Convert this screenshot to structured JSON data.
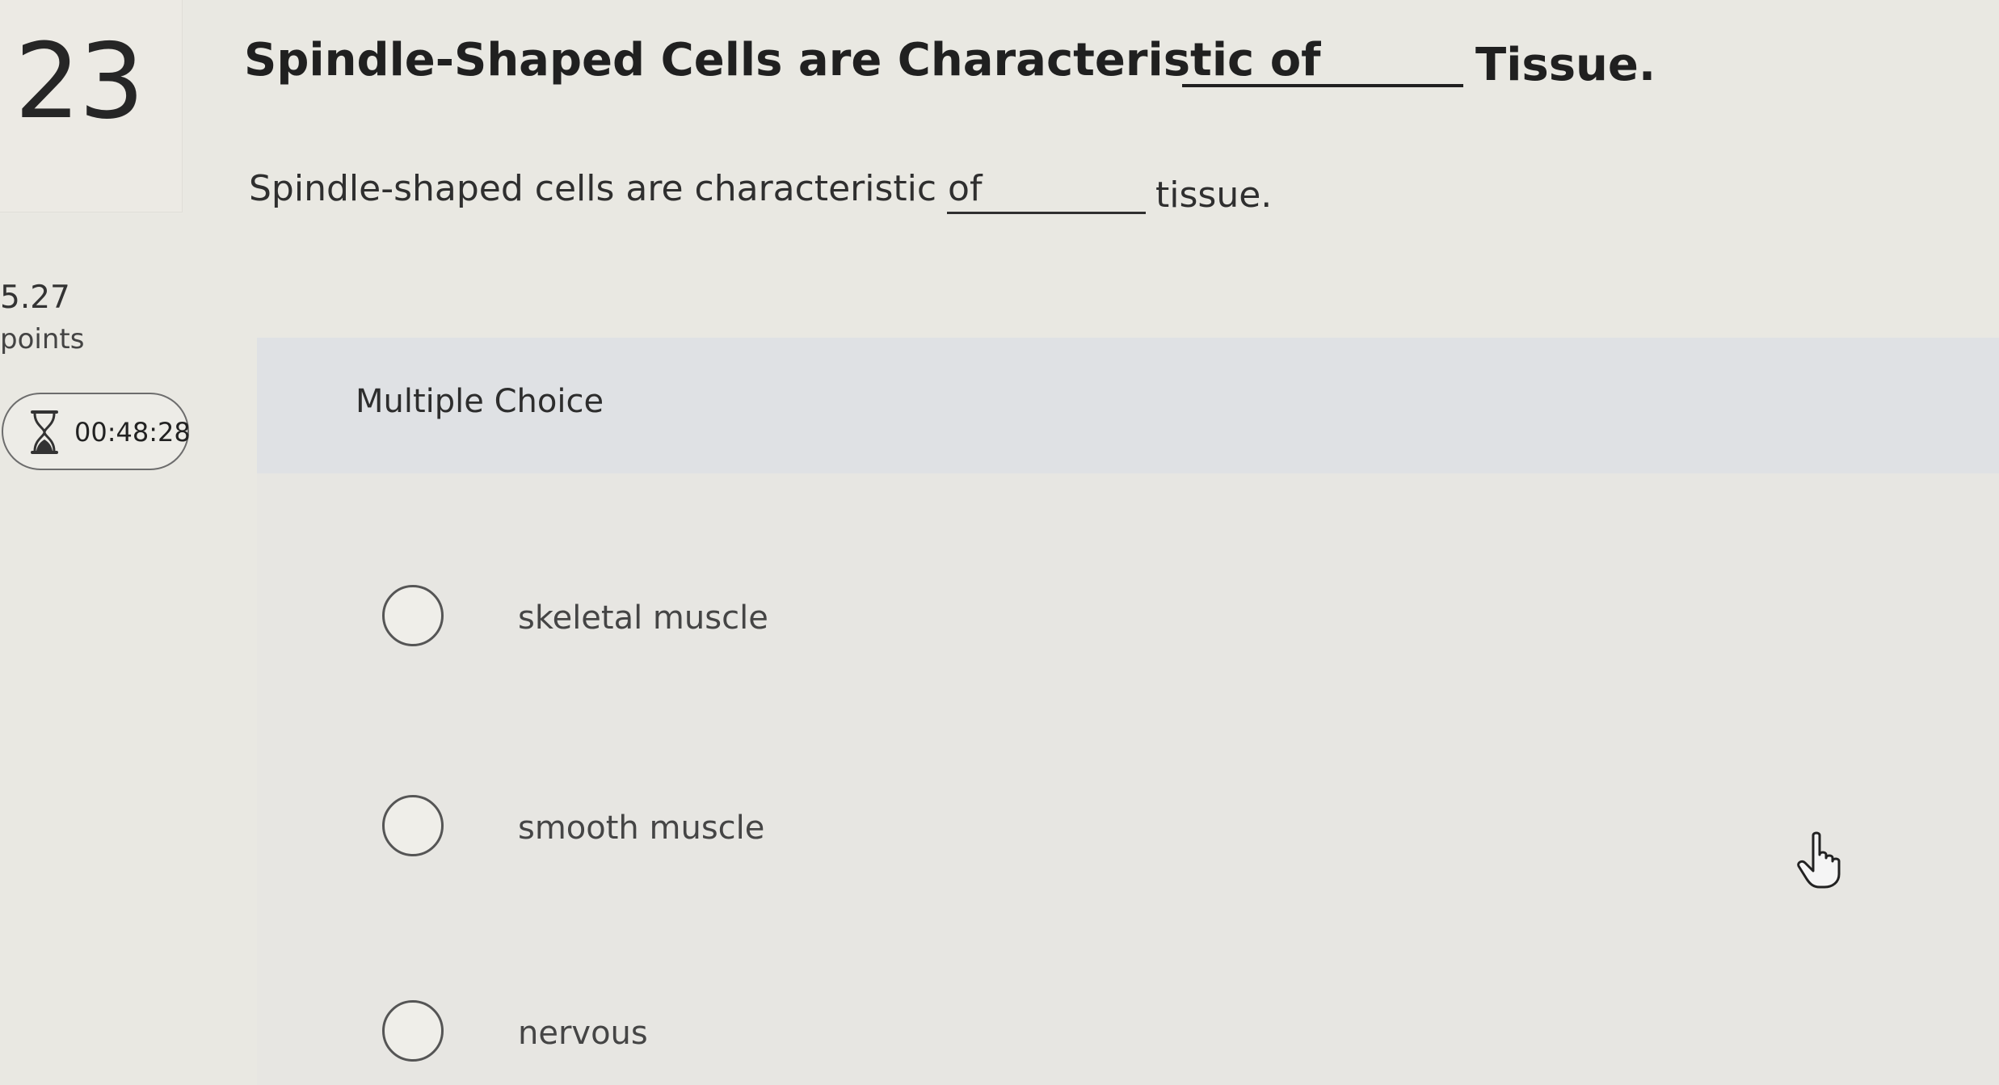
{
  "question": {
    "number": "23",
    "title_start": "Spindle-Shaped Cells are Characteristic of",
    "title_end": "Tissue.",
    "prompt_start": "Spindle-shaped cells are characteristic of",
    "prompt_end": "tissue."
  },
  "points": {
    "value": "5.27",
    "label": "points"
  },
  "timer": {
    "icon": "hourglass-icon",
    "time": "00:48:28"
  },
  "multiple_choice": {
    "header": "Multiple Choice",
    "options": [
      {
        "label": "skeletal muscle"
      },
      {
        "label": "smooth muscle"
      },
      {
        "label": "nervous"
      }
    ]
  },
  "cursor": {
    "icon": "hand-pointer-icon"
  }
}
